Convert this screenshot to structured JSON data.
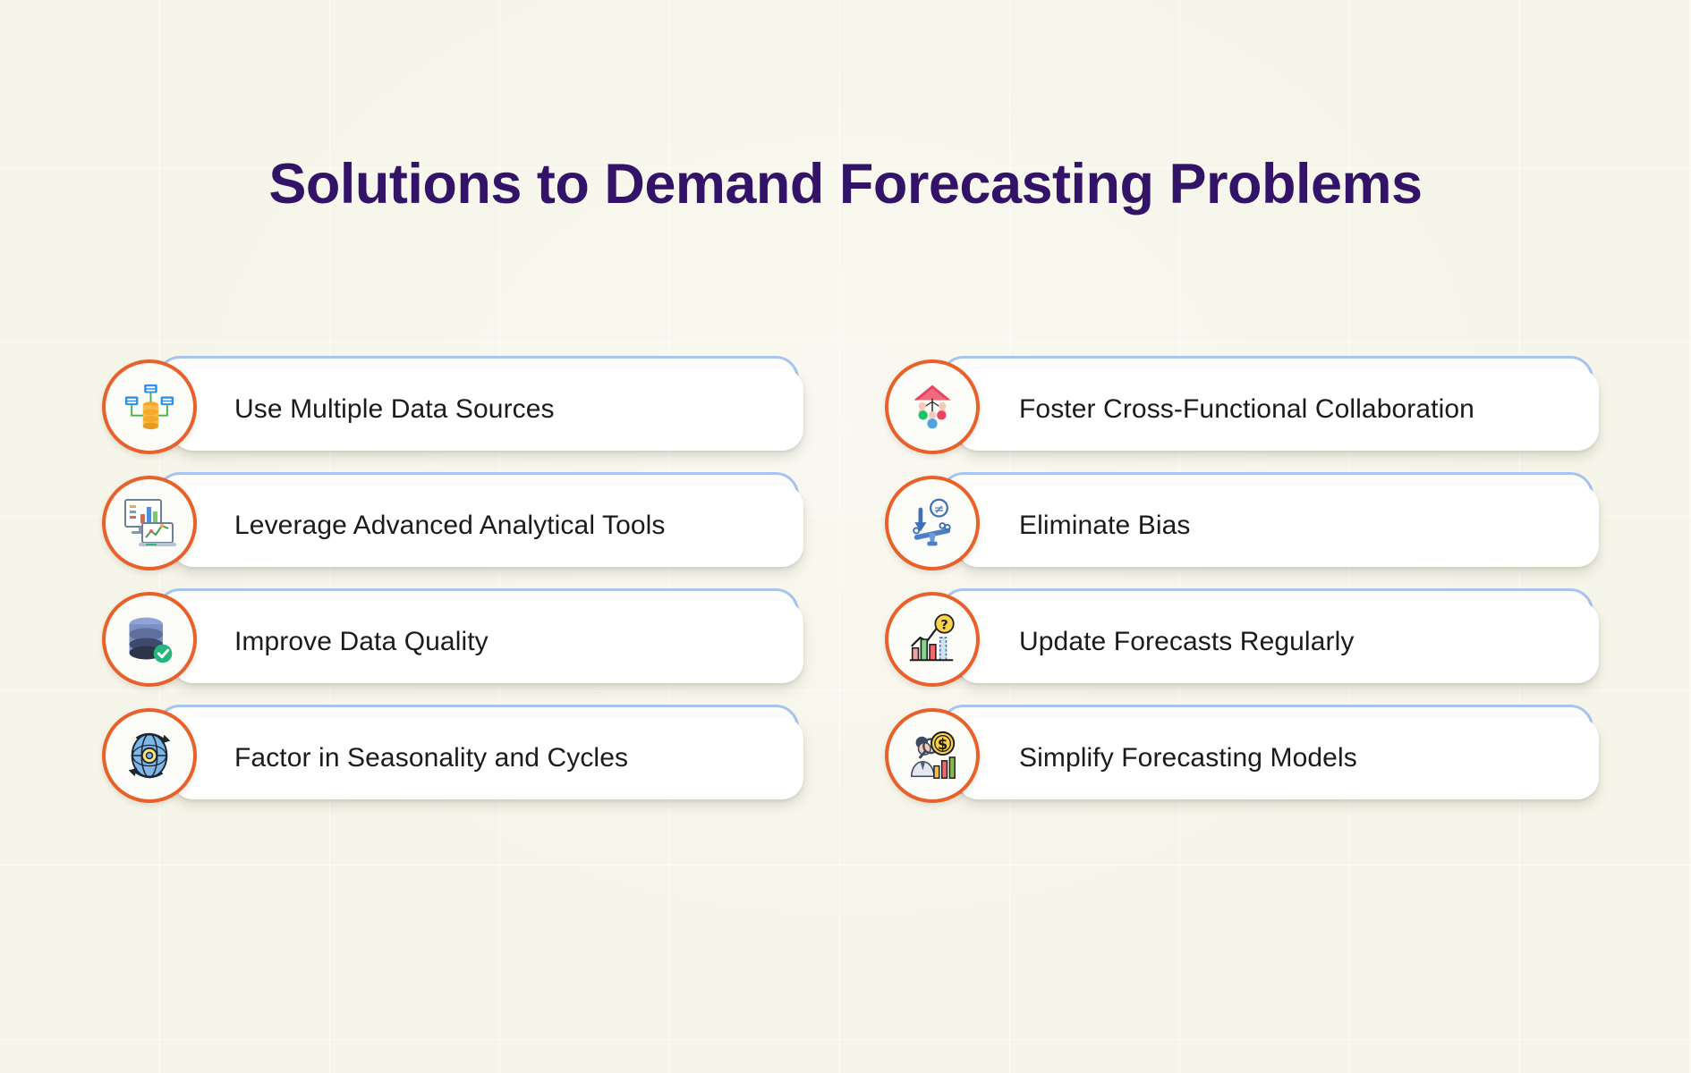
{
  "page": {
    "title": "Solutions to Demand Forecasting Problems",
    "background_color": "#f6f5e9",
    "title_color": "#331367",
    "accent_ring_color": "#e8612a",
    "plate_outline_color": "#a8c3ef",
    "card_color": "#ffffff"
  },
  "columns": [
    {
      "side": "left",
      "items": [
        {
          "label": "Use Multiple Data Sources",
          "icon": "database-network-icon"
        },
        {
          "label": "Leverage Advanced Analytical Tools",
          "icon": "analytics-dashboard-icon"
        },
        {
          "label": "Improve Data Quality",
          "icon": "database-check-icon"
        },
        {
          "label": "Factor in Seasonality and Cycles",
          "icon": "globe-gear-cycle-icon"
        }
      ]
    },
    {
      "side": "right",
      "items": [
        {
          "label": "Foster Cross-Functional Collaboration",
          "icon": "team-hierarchy-icon"
        },
        {
          "label": "Eliminate Bias",
          "icon": "seesaw-balance-icon"
        },
        {
          "label": "Update Forecasts Regularly",
          "icon": "bar-chart-question-icon"
        },
        {
          "label": "Simplify Forecasting Models",
          "icon": "analyst-money-chart-icon"
        }
      ]
    }
  ]
}
